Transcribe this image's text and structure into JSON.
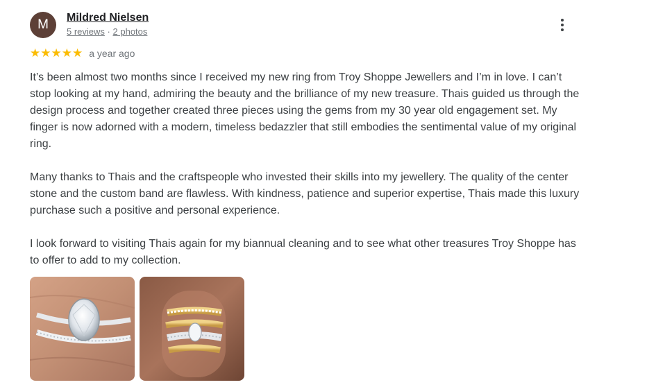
{
  "review": {
    "author": {
      "initial": "M",
      "name": "Mildred Nielsen",
      "reviews_count": "5 reviews",
      "separator": "·",
      "photos_count": "2 photos",
      "avatar_color": "#5d4037"
    },
    "rating": {
      "stars_text": "★★★★★",
      "value": 5,
      "max": 5,
      "star_color": "#fbbc04"
    },
    "time_ago": "a year ago",
    "paragraphs": [
      "It’s been almost two months since I received my new ring from Troy Shoppe Jewellers and I’m in love. I can’t stop looking at my hand, admiring the beauty and the brilliance of my new treasure. Thais guided us through the design process and together created three pieces using the gems from my 30 year old engagement set. My finger is now adorned with a modern, timeless bedazzler that still embodies the sentimental value of my original ring.",
      "Many thanks to Thais and the craftspeople who invested their skills into my jewellery. The quality of the center stone and the custom band are flawless. With kindness, patience and superior expertise, Thais made this luxury purchase such a positive and personal experience.",
      "I look forward to visiting Thais again for my biannual cleaning and to see what other treasures Troy Shoppe has to offer to add to my collection."
    ],
    "more_icon": "more-vert-icon",
    "photos": [
      {
        "subject": "oval diamond engagement ring with pave band on finger"
      },
      {
        "subject": "stacked gold and diamond ring set on finger"
      }
    ]
  }
}
